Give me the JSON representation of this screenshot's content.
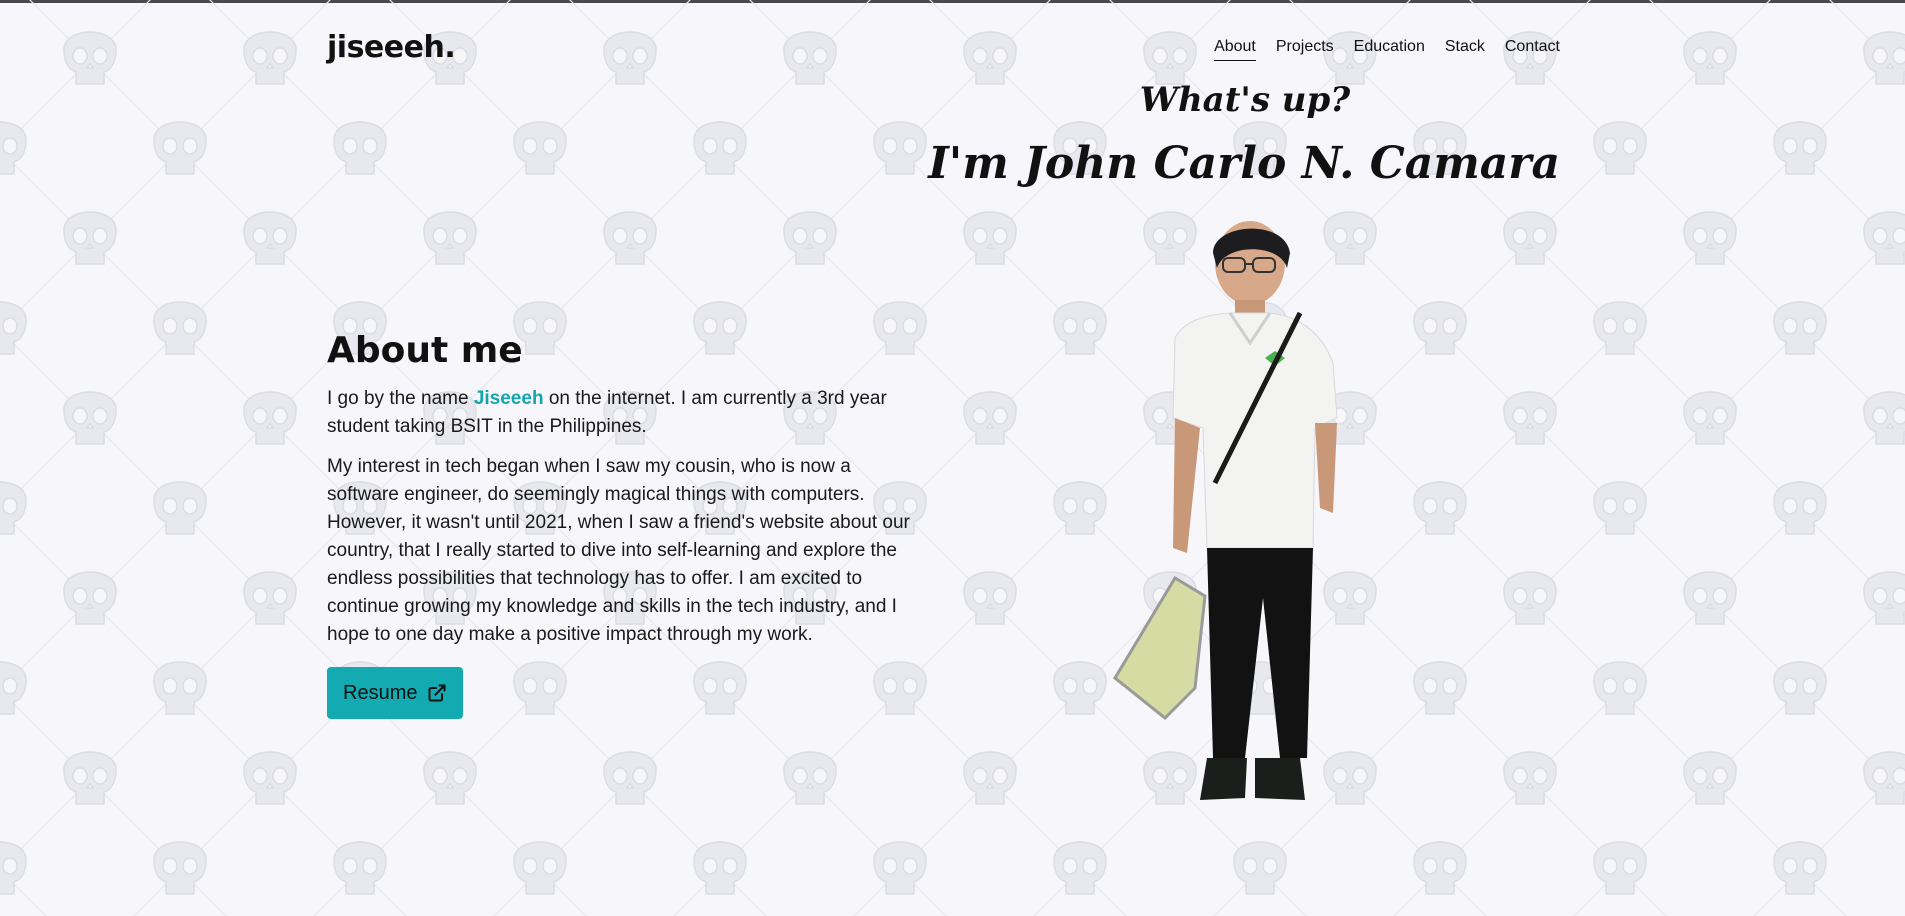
{
  "header": {
    "brand": "jiseeeh.",
    "nav": [
      {
        "label": "About",
        "active": true
      },
      {
        "label": "Projects",
        "active": false
      },
      {
        "label": "Education",
        "active": false
      },
      {
        "label": "Stack",
        "active": false
      },
      {
        "label": "Contact",
        "active": false
      }
    ]
  },
  "hero": {
    "greeting": "What's up?",
    "name_line": "I'm John Carlo N. Camara"
  },
  "about": {
    "heading": "About me",
    "p1_before": "I go by the name ",
    "p1_highlight": "Jiseeeh",
    "p1_after": " on the internet. I am currently a 3rd year student taking BSIT in the Philippines.",
    "p2": "My interest in tech began when I saw my cousin, who is now a software engineer, do seemingly magical things with computers. However, it wasn't until 2021, when I saw a friend's website about our country, that I really started to dive into self-learning and explore the endless possibilities that technology has to offer. I am excited to continue growing my knowledge and skills in the tech industry, and I hope to one day make a positive impact through my work.",
    "resume_label": "Resume",
    "resume_icon": "external-link-icon"
  },
  "colors": {
    "accent": "#14aab2",
    "highlight": "#13a7ad",
    "background": "#f7f7fb"
  }
}
